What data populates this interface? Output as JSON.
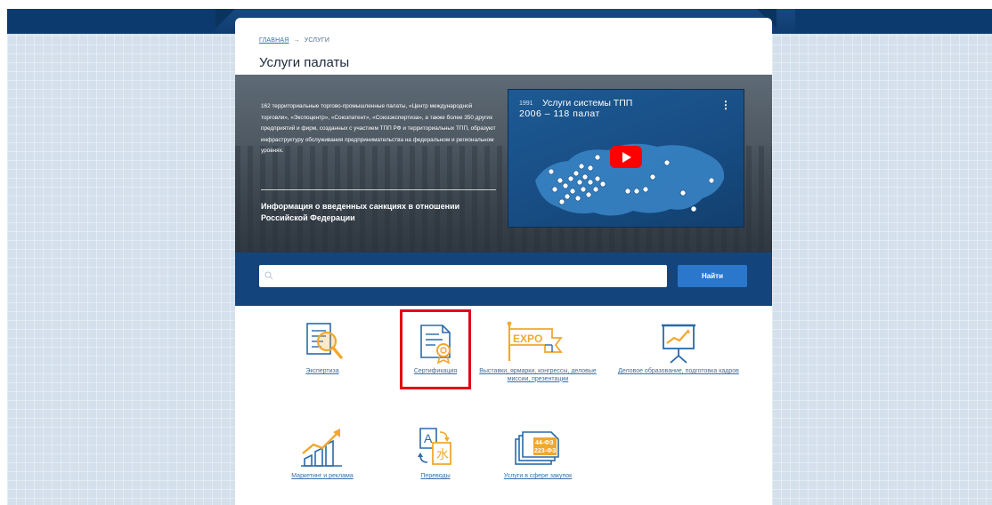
{
  "breadcrumb": {
    "home": "главная",
    "arrow": "→",
    "current": "услуги"
  },
  "page": {
    "title": "Услуги палаты"
  },
  "hero": {
    "text": "162 территориальные торгово-промышленные палаты, «Центр международной торговли», «Экспоцентр», «Союзпатент», «Союзэкспертиза», а также более 350 других предприятий и фирм, созданных с участием ТПП РФ и территориальных ТПП, образуют инфраструктуру обслуживания предпринимательства на федеральном и региональном уровнях.",
    "link": "Информация о введенных санкциях в отношении Российской Федерации"
  },
  "video": {
    "year": "1991",
    "title": "Услуги системы ТПП",
    "subtitle": "2006 – 118 палат",
    "menu_icon": "more-vertical-icon",
    "play_icon": "play-icon"
  },
  "search": {
    "placeholder": "",
    "button": "Найти"
  },
  "services": [
    {
      "label": "Экспертиза",
      "icon": "document-magnifier-icon"
    },
    {
      "label": "Сертификация",
      "icon": "certificate-icon"
    },
    {
      "label": "Выставки, ярмарки, конгрессы, деловые миссии, презентации",
      "icon": "expo-flag-icon",
      "badge": "EXPO"
    },
    {
      "label": "Деловое образование, подготовка кадров",
      "icon": "presentation-board-icon"
    },
    {
      "label": "Маркетинг и реклама",
      "icon": "growth-chart-icon"
    },
    {
      "label": "Переводы",
      "icon": "translation-icon",
      "glyph_a": "A",
      "glyph_b": "水"
    },
    {
      "label": "Услуги в сфере закупок",
      "icon": "procurement-docs-icon",
      "law_1": "44-ФЗ",
      "law_2": "223-ФЗ"
    }
  ],
  "colors": {
    "brand_dark": "#13457c",
    "accent_orange": "#f0a830",
    "icon_blue": "#2a6aa8",
    "link": "#3a6ea5",
    "highlight": "#e30613"
  }
}
